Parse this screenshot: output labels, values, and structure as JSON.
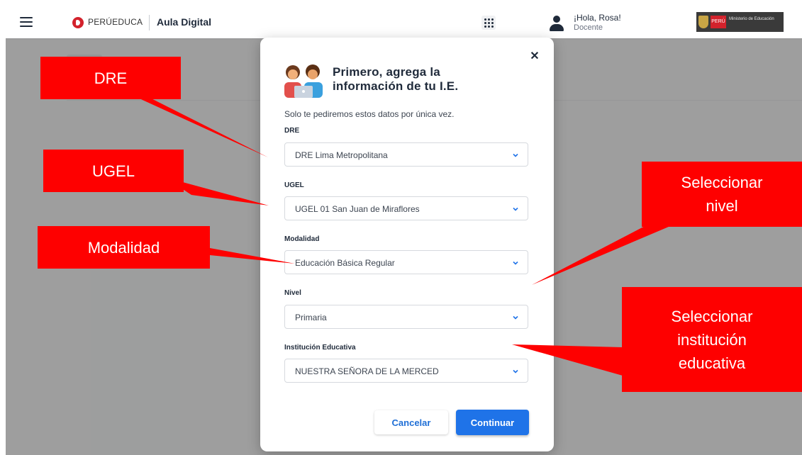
{
  "header": {
    "brand": "PERÚEDUCA",
    "app_name": "Aula Digital",
    "greeting": "¡Hola, Rosa!",
    "role": "Docente",
    "ministry_peru": "PERÚ",
    "ministry_name": "Ministerio de Educación"
  },
  "modal": {
    "title_line1": "Primero, agrega la",
    "title_line2": "información de tu I.E.",
    "subtitle": "Solo te pediremos estos datos por única vez.",
    "fields": [
      {
        "label": "DRE",
        "value": "DRE Lima Metropolitana"
      },
      {
        "label": "UGEL",
        "value": "UGEL 01 San Juan de Miraflores"
      },
      {
        "label": "Modalidad",
        "value": "Educación Básica Regular"
      },
      {
        "label": "Nivel",
        "value": "Primaria"
      },
      {
        "label": "Institución Educativa",
        "value": "NUESTRA SEÑORA DE LA MERCED"
      }
    ],
    "cancel_label": "Cancelar",
    "continue_label": "Continuar"
  },
  "annotations": {
    "dre": "DRE",
    "ugel": "UGEL",
    "modalidad": "Modalidad",
    "nivel_line1": "Seleccionar",
    "nivel_line2": "nivel",
    "ie_line1": "Seleccionar",
    "ie_line2": "institución",
    "ie_line3": "educativa"
  },
  "colors": {
    "primary_button": "#1f73e8",
    "link_blue": "#1f6fd6",
    "annotation_red": "#fe0000",
    "overlay": "#808080"
  }
}
